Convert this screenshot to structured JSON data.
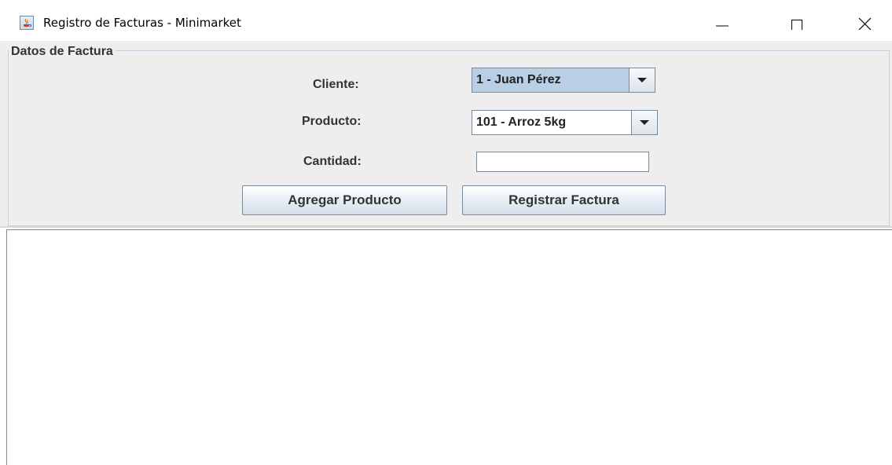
{
  "window": {
    "title": "Registro de Facturas - Minimarket",
    "icon": "java-cup-icon"
  },
  "form": {
    "legend": "Datos de Factura",
    "cliente": {
      "label": "Cliente:",
      "selected": "1 - Juan Pérez"
    },
    "producto": {
      "label": "Producto:",
      "selected": "101 - Arroz 5kg"
    },
    "cantidad": {
      "label": "Cantidad:",
      "value": ""
    },
    "buttons": {
      "add": "Agregar Producto",
      "register": "Registrar Factura"
    }
  },
  "colors": {
    "panel_bg": "#eeeeee",
    "combo_selected_bg": "#b8cfe5",
    "text": "#333333"
  }
}
